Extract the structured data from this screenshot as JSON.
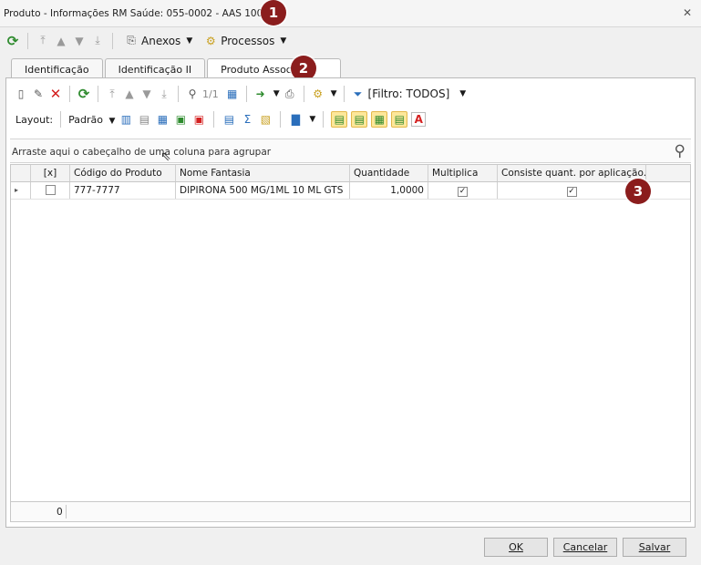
{
  "window": {
    "title": "Produto - Informações RM Saúde: 055-0002 - AAS 100 MG",
    "close_symbol": "✕"
  },
  "badges": [
    "1",
    "2",
    "3"
  ],
  "main_toolbar": {
    "anexos_label": "Anexos",
    "processos_label": "Processos"
  },
  "tabs": [
    {
      "label": "Identificação"
    },
    {
      "label": "Identificação II"
    },
    {
      "label": "Produto Associado"
    }
  ],
  "inner_toolbar": {
    "page_indicator": "1/1",
    "filter_label": "[Filtro: TODOS]"
  },
  "layout_toolbar": {
    "layout_label": "Layout:",
    "padrao_label": "Padrão"
  },
  "group_bar": {
    "text": "Arraste aqui o cabeçalho de uma coluna para agrupar"
  },
  "grid": {
    "columns": [
      "[x]",
      "Código do Produto",
      "Nome Fantasia",
      "Quantidade",
      "Multiplica",
      "Consiste quant. por aplicação."
    ],
    "rows": [
      {
        "selected": false,
        "codigo": "777-7777",
        "nome": "DIPIRONA 500 MG/1ML 10 ML GTS",
        "quantidade": "1,0000",
        "multiplica": true,
        "consiste": true
      }
    ],
    "footer_count": "0"
  },
  "buttons": {
    "ok": "OK",
    "cancelar": "Cancelar",
    "salvar": "Salvar"
  },
  "colors": {
    "badge": "#8b1d1d",
    "refresh_icon": "#2e8b2e",
    "delete_icon": "#d42020",
    "highlight": "#fde79a"
  }
}
